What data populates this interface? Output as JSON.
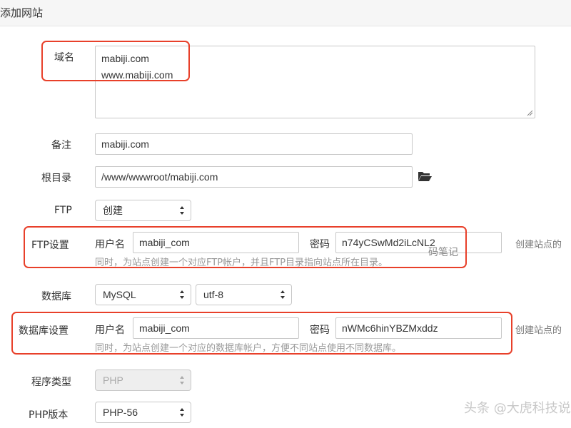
{
  "header": {
    "title": "添加网站"
  },
  "domain": {
    "label": "域名",
    "lines": [
      "mabiji.com",
      "www.mabiji.com"
    ]
  },
  "remark": {
    "label": "备注",
    "value": "mabiji.com"
  },
  "root_dir": {
    "label": "根目录",
    "value": "/www/wwwroot/mabiji.com",
    "icon": "folder-open-icon"
  },
  "ftp": {
    "label": "FTP",
    "selected": "创建"
  },
  "ftp_settings": {
    "label": "FTP设置",
    "username_label": "用户名",
    "username": "mabiji_com",
    "password_label": "密码",
    "password": "n74yCSwMd2iLcNL2",
    "side_text": "创建站点的",
    "hint": "同时，为站点创建一个对应FTP帐户，并且FTP目录指向站点所在目录。"
  },
  "database": {
    "label": "数据库",
    "type_selected": "MySQL",
    "charset_selected": "utf-8"
  },
  "db_settings": {
    "label": "数据库设置",
    "username_label": "用户名",
    "username": "mabiji_com",
    "password_label": "密码",
    "password": "nWMc6hinYBZMxddz",
    "side_text": "创建站点的",
    "hint": "同时，为站点创建一个对应的数据库帐户，方便不同站点使用不同数据库。"
  },
  "program_type": {
    "label": "程序类型",
    "selected": "PHP"
  },
  "php_version": {
    "label": "PHP版本",
    "selected": "PHP-56"
  },
  "watermarks": {
    "small": "码笔记",
    "large": "头条 @大虎科技说"
  },
  "colors": {
    "highlight": "#e8402a"
  }
}
